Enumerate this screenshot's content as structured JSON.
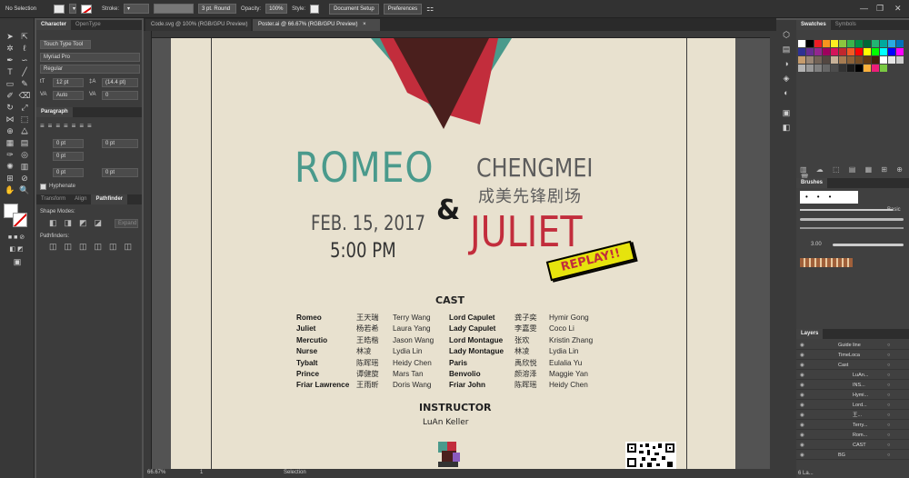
{
  "control_bar": {
    "selection_label": "No Selection",
    "stroke_label": "Stroke:",
    "brush_value": "3 pt. Round",
    "opacity_label": "Opacity:",
    "opacity_value": "100%",
    "style_label": "Style:",
    "document_setup": "Document Setup",
    "preferences": "Preferences"
  },
  "document_tabs": [
    {
      "label": "Code.svg @ 100% (RGB/GPU Preview)",
      "close": "×"
    },
    {
      "label": "Poster.ai @ 66.67% (RGB/GPU Preview)",
      "close": "×"
    }
  ],
  "character_panel": {
    "tabs": [
      "Character",
      "OpenType"
    ],
    "touch_type": "Touch Type Tool",
    "font_family": "Myriad Pro",
    "font_style": "Regular",
    "font_size": "12 pt",
    "leading": "(14.4 pt)",
    "kerning": "Auto",
    "tracking": "0"
  },
  "paragraph_panel": {
    "tab": "Paragraph",
    "indent_left": "0 pt",
    "indent_right": "0 pt",
    "first_line": "0 pt",
    "space_before": "0 pt",
    "space_after": "0 pt",
    "hyphenate": "Hyphenate"
  },
  "pathfinder_panel": {
    "tabs": [
      "Transform",
      "Align",
      "Pathfinder"
    ],
    "shape_modes": "Shape Modes:",
    "expand": "Expand",
    "pathfinders": "Pathfinders:"
  },
  "poster": {
    "romeo": "ROMEO",
    "amp": "&",
    "juliet": "JULIET",
    "date": "FEB. 15, 2017",
    "time": "5:00 PM",
    "chengmei": "CHENGMEI",
    "chengmei_cn": "成美先锋剧场",
    "replay": "REPLAY!!",
    "cast_heading": "CAST",
    "roles_left": [
      "Romeo",
      "Juliet",
      "Mercutio",
      "Nurse",
      "Tybalt",
      "Prince",
      "Friar Lawrence"
    ],
    "cn_left": [
      "王天瑞",
      "杨若希",
      "王皓楷",
      "林凌",
      "陈晖瑶",
      "谭健旋",
      "王雨昕"
    ],
    "actors_left": [
      "Terry Wang",
      "Laura Yang",
      "Jason Wang",
      "Lydia Lin",
      "Heidy Chen",
      "Mars Tan",
      "Doris Wang"
    ],
    "roles_right": [
      "Lord Capulet",
      "Lady Capulet",
      "Lord Montague",
      "Lady Montague",
      "Paris",
      "Benvolio",
      "Friar John"
    ],
    "cn_right": [
      "龚子奕",
      "李嘉雯",
      "张欢",
      "林凌",
      "禹欣悦",
      "颜溶泽",
      "陈晖瑶"
    ],
    "actors_right": [
      "Hymir Gong",
      "Coco Li",
      "Kristin Zhang",
      "Lydia Lin",
      "Eulalia Yu",
      "Maggie Yan",
      "Heidy Chen"
    ],
    "instructor_heading": "INSTRUCTOR",
    "instructor": "LuAn Keller",
    "colors": {
      "teal": "#4a9a8c",
      "red": "#c22d3c",
      "dark": "#4a1f1d",
      "gray": "#5c5c5c",
      "paper": "#e8e1cf"
    }
  },
  "swatches_panel": {
    "tabs": [
      "Swatches",
      "Symbols"
    ],
    "colors": [
      "#ffffff",
      "#000000",
      "#ed1c24",
      "#f7931e",
      "#fcee21",
      "#8cc63f",
      "#39b54a",
      "#009245",
      "#006837",
      "#22b573",
      "#00a99d",
      "#29abe2",
      "#0071bc",
      "#2e3192",
      "#662d91",
      "#93278f",
      "#9e005d",
      "#d4145a",
      "#c1272d",
      "#f15a24",
      "#ff0000",
      "#ffff00",
      "#00ff00",
      "#00ffff",
      "#0000ff",
      "#ff00ff",
      "#c69c6d",
      "#998675",
      "#736357",
      "#534741",
      "#c7b299",
      "#a67c52",
      "#8c6239",
      "#754c24",
      "#603813",
      "#42210b",
      "#ffffff",
      "#e6e6e6",
      "#cccccc",
      "#b3b3b3",
      "#999999",
      "#808080",
      "#666666",
      "#4d4d4d",
      "#333333",
      "#1a1a1a",
      "#000000",
      "#fbb03b",
      "#ed1e79",
      "#7ac943"
    ]
  },
  "brushes_panel": {
    "tab": "Brushes",
    "basic": "Basic",
    "size": "3.00"
  },
  "layers_panel": {
    "tab": "Layers",
    "rows": [
      "Guide line",
      "TimeLoca",
      "Cast",
      "LuAn...",
      "INS...",
      "Hymi...",
      "Lord...",
      "王...",
      "Terry...",
      "Rom...",
      "CAST",
      "BG"
    ],
    "footer": "6 La..."
  },
  "status_bar": {
    "zoom": "66.67%",
    "artboard": "1",
    "mode": "Selection"
  }
}
